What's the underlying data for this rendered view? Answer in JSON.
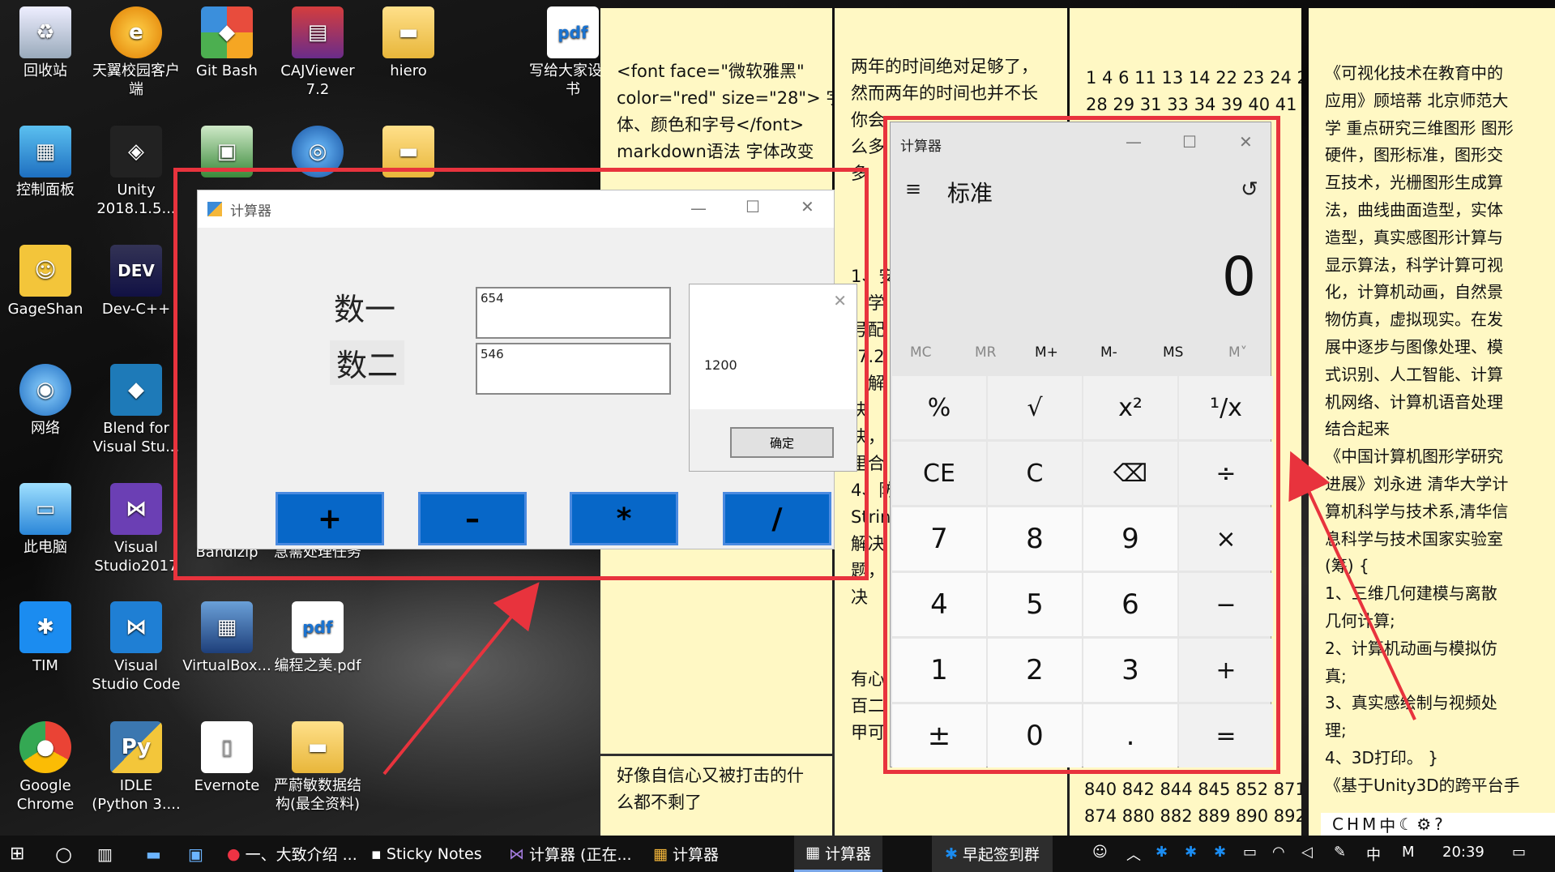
{
  "desktop_icons": [
    {
      "label": "回收站",
      "icon": "recycle-bin-icon"
    },
    {
      "label": "天翼校园客户端",
      "icon": "tianyi-client-icon"
    },
    {
      "label": "Git Bash",
      "icon": "git-bash-icon"
    },
    {
      "label": "CAJViewer 7.2",
      "icon": "cajviewer-icon"
    },
    {
      "label": "hiero",
      "icon": "folder-icon"
    },
    {
      "label": "写给大家设计书",
      "icon": "pdf-icon"
    },
    {
      "label": "控制面板",
      "icon": "control-panel-icon"
    },
    {
      "label": "Unity 2018.1.5...",
      "icon": "unity-icon"
    },
    {
      "label": "GageShan",
      "icon": "user-folder-icon"
    },
    {
      "label": "Dev-C++",
      "icon": "devcpp-icon"
    },
    {
      "label": "网络",
      "icon": "network-icon"
    },
    {
      "label": "Blend for Visual Stu...",
      "icon": "blend-icon"
    },
    {
      "label": "此电脑",
      "icon": "this-pc-icon"
    },
    {
      "label": "Visual Studio2017",
      "icon": "visual-studio-icon"
    },
    {
      "label": "Bandizip",
      "icon": "bandizip-icon"
    },
    {
      "label": "急需处理任务",
      "icon": "folder-icon"
    },
    {
      "label": "TIM",
      "icon": "tim-icon"
    },
    {
      "label": "Visual Studio Code",
      "icon": "vscode-icon"
    },
    {
      "label": "VirtualBox...",
      "icon": "virtualbox-icon"
    },
    {
      "label": "编程之美.pdf",
      "icon": "pdf-icon"
    },
    {
      "label": "Google Chrome",
      "icon": "chrome-icon"
    },
    {
      "label": "IDLE (Python 3....",
      "icon": "python-idle-icon"
    },
    {
      "label": "Evernote",
      "icon": "evernote-icon"
    },
    {
      "label": "严蔚敏数据结构(最全资料)",
      "icon": "folder-icon"
    }
  ],
  "notes": {
    "note1": [
      "<font face=\"微软雅黑\"",
      "color=\"red\" size=\"28\"> 字",
      "体、颜色和字号</font>",
      "markdown语法 字体改变"
    ],
    "note1b": [
      "好像自信心又被打击的什",
      "么都不剩了"
    ],
    "note2": [
      "两年的时间绝对足够了，",
      "然而两年的时间也并不长",
      "你会",
      "么多",
      "多"
    ],
    "note2b": [
      "1、安",
      "、学",
      "号配",
      "(7.2",
      "、解",
      "决",
      "决，",
      "里合",
      "4、防",
      "Strin",
      "解决",
      "题，",
      "决"
    ],
    "note2c": [
      "有心",
      "百二",
      "甲可"
    ],
    "note3": [
      "1 4 6 11 13 14 22 23 24 26",
      "28 29 31 33 34 39 40 41 48"
    ],
    "note3b": [
      "840 842 844 845 852 871",
      "874 880 882 889 890 892"
    ],
    "note4": [
      "《可视化技术在教育中的",
      "应用》顾培蒂 北京师范大",
      "学 重点研究三维图形 图形",
      "硬件，图形标准，图形交",
      "互技术，光栅图形生成算",
      "法，曲线曲面造型，实体",
      "造型，真实感图形计算与",
      "显示算法，科学计算可视",
      "化，计算机动画，自然景",
      "物仿真，虚拟现实。在发",
      "展中逐步与图像处理、模",
      "式识别、人工智能、计算",
      "机网络、计算机语音处理",
      "结合起来",
      "《中国计算机图形学研究",
      "进展》刘永进 清华大学计",
      "算机科学与技术系,清华信",
      "息科学与技术国家实验室",
      "(筹)  {",
      "  1、三维几何建模与离散",
      "几何计算;",
      "  2、计算机动画与模拟仿",
      "真;",
      "  3、真实感绘制与视频处",
      "理;",
      "  4、3D打印。 }",
      "《基于Unity3D的跨平台手"
    ]
  },
  "form_calc": {
    "title": "计算器",
    "label1": "数一",
    "label2": "数二",
    "value1": "654",
    "value2": "546",
    "buttons": [
      "+",
      "–",
      "*",
      "/"
    ],
    "message": {
      "value": "1200",
      "ok": "确定"
    }
  },
  "win_calc": {
    "title": "计算器",
    "mode": "标准",
    "display": "0",
    "memory": [
      "MC",
      "MR",
      "M+",
      "M-",
      "MS",
      "M˅"
    ],
    "rows": [
      [
        "%",
        "√",
        "x²",
        "¹/x"
      ],
      [
        "CE",
        "C",
        "⌫",
        "÷"
      ],
      [
        "7",
        "8",
        "9",
        "×"
      ],
      [
        "4",
        "5",
        "6",
        "−"
      ],
      [
        "1",
        "2",
        "3",
        "+"
      ],
      [
        "±",
        "0",
        ".",
        "="
      ]
    ]
  },
  "taskbar": {
    "items": [
      "一、大致介绍 ...",
      "Sticky Notes",
      "计算器 (正在...",
      "计算器",
      "计算器",
      "早起签到群"
    ],
    "ime": "CH",
    "ime_lang": "中",
    "ime_m": "M",
    "clock": "20:39"
  },
  "colors": {
    "note": "#fff8c4",
    "highlight": "#e8333d",
    "button_blue": "#0767c8"
  }
}
